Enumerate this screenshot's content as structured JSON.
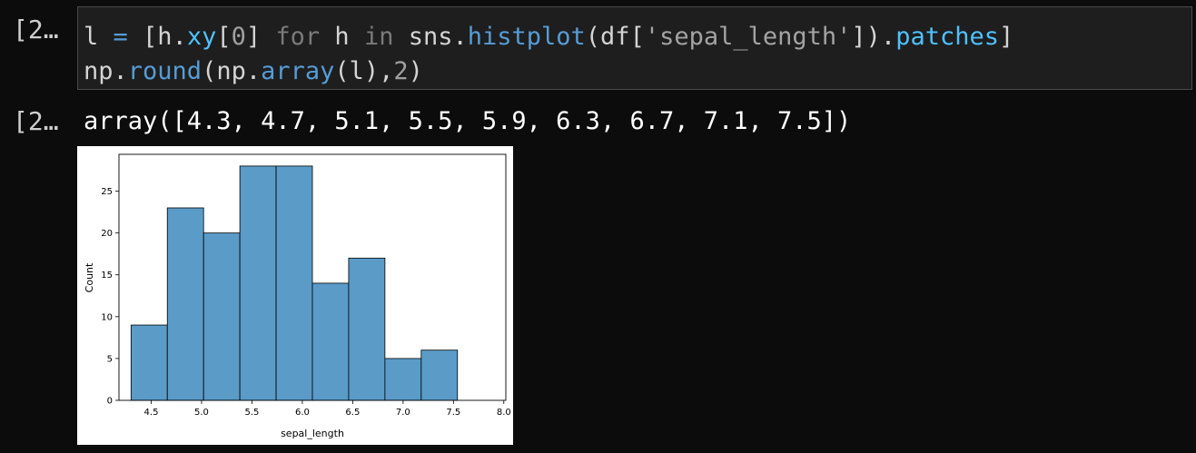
{
  "cells": [
    {
      "prompt": "[2…",
      "code_lines": [
        [
          {
            "t": "l",
            "c": "t-var"
          },
          {
            "t": " ",
            "c": "t-var"
          },
          {
            "t": "=",
            "c": "t-op"
          },
          {
            "t": " [h.",
            "c": "t-punct"
          },
          {
            "t": "xy",
            "c": "t-attr"
          },
          {
            "t": "[",
            "c": "t-punct"
          },
          {
            "t": "0",
            "c": "t-num"
          },
          {
            "t": "] ",
            "c": "t-punct"
          },
          {
            "t": "for",
            "c": "t-kw"
          },
          {
            "t": " h ",
            "c": "t-var"
          },
          {
            "t": "in",
            "c": "t-kw"
          },
          {
            "t": " sns.",
            "c": "t-var"
          },
          {
            "t": "histplot",
            "c": "t-func"
          },
          {
            "t": "(df[",
            "c": "t-punct"
          },
          {
            "t": "'sepal_length'",
            "c": "t-str"
          },
          {
            "t": "]).",
            "c": "t-punct"
          },
          {
            "t": "patches",
            "c": "t-attr"
          },
          {
            "t": "]",
            "c": "t-punct"
          }
        ],
        [
          {
            "t": "np.",
            "c": "t-var"
          },
          {
            "t": "round",
            "c": "t-func"
          },
          {
            "t": "(np.",
            "c": "t-punct"
          },
          {
            "t": "array",
            "c": "t-func"
          },
          {
            "t": "(l),",
            "c": "t-punct"
          },
          {
            "t": "2",
            "c": "t-num"
          },
          {
            "t": ")",
            "c": "t-punct"
          }
        ]
      ]
    }
  ],
  "output": {
    "prompt": "[2…",
    "text": "array([4.3, 4.7, 5.1, 5.5, 5.9, 6.3, 6.7, 7.1, 7.5])"
  },
  "chart_data": {
    "type": "bar",
    "title": "",
    "xlabel": "sepal_length",
    "ylabel": "Count",
    "bin_edges": [
      4.3,
      4.66,
      5.02,
      5.38,
      5.74,
      6.1,
      6.46,
      6.82,
      7.18,
      7.54,
      7.9
    ],
    "values": [
      9,
      23,
      20,
      28,
      28,
      14,
      17,
      5,
      6
    ],
    "bins": [
      {
        "x0": 4.3,
        "x1": 4.7,
        "value": 9
      },
      {
        "x0": 4.7,
        "x1": 5.1,
        "value": 23
      },
      {
        "x0": 5.1,
        "x1": 5.5,
        "value": 20
      },
      {
        "x0": 5.5,
        "x1": 5.9,
        "value": 28
      },
      {
        "x0": 5.9,
        "x1": 6.3,
        "value": 28
      },
      {
        "x0": 6.3,
        "x1": 6.7,
        "value": 14
      },
      {
        "x0": 6.7,
        "x1": 7.1,
        "value": 17
      },
      {
        "x0": 7.1,
        "x1": 7.5,
        "value": 5
      },
      {
        "x0": 7.5,
        "x1": 7.9,
        "value": 6
      }
    ],
    "xlim": [
      4.18,
      8.02
    ],
    "ylim": [
      0,
      29.4
    ],
    "xticks": [
      "4.5",
      "5.0",
      "5.5",
      "6.0",
      "6.5",
      "7.0",
      "7.5",
      "8.0"
    ],
    "yticks": [
      "0",
      "5",
      "10",
      "15",
      "20",
      "25"
    ],
    "bar_color": "#5a9bc8",
    "grid": false
  }
}
